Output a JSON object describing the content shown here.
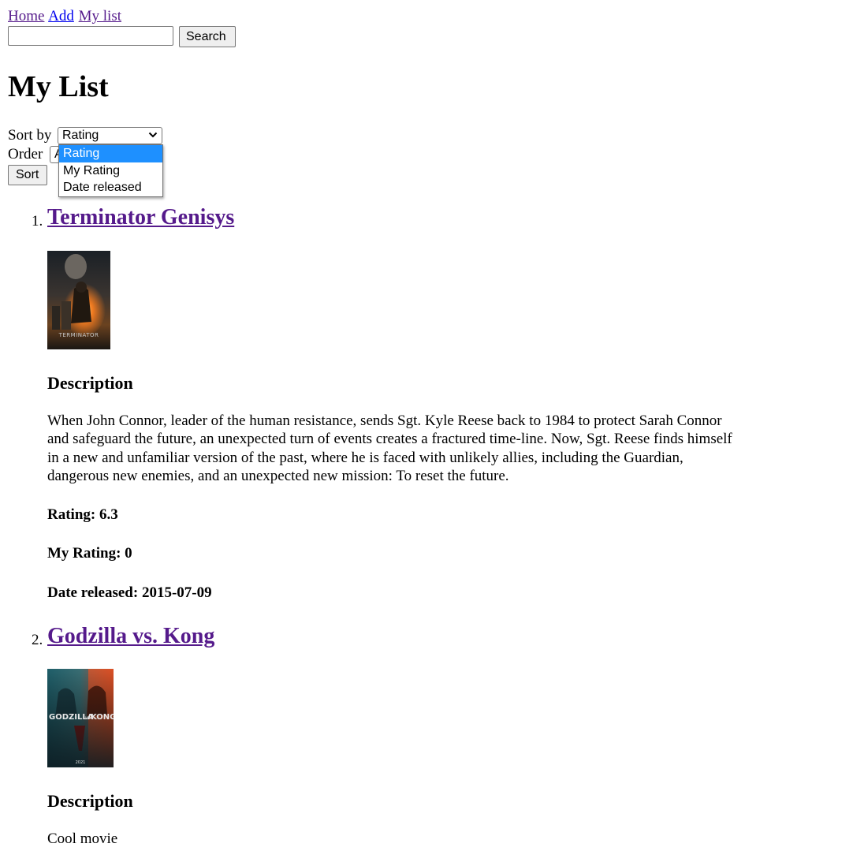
{
  "nav": {
    "home": "Home",
    "add": "Add",
    "my_list": "My list"
  },
  "search": {
    "value": "",
    "button": "Search"
  },
  "page_title": "My List",
  "sort": {
    "label": "Sort by",
    "selected": "Rating",
    "options": [
      "Rating",
      "My Rating",
      "Date released"
    ],
    "order_label": "Order",
    "order_selected_partial": "A",
    "button": "Sort"
  },
  "movies": [
    {
      "number": "1.",
      "title": "Terminator Genisys",
      "description_heading": "Description",
      "description": "When John Connor, leader of the human resistance, sends Sgt. Kyle Reese back to 1984 to protect Sarah Connor and safeguard the future, an unexpected turn of events creates a fractured time-line. Now, Sgt. Reese finds himself in a new and unfamiliar version of the past, where he is faced with unlikely allies, including the Guardian, dangerous new enemies, and an unexpected new mission: To reset the future.",
      "rating": "Rating: 6.3",
      "my_rating": "My Rating: 0",
      "date_released": "Date released: 2015-07-09",
      "poster_text": "TERMINATOR"
    },
    {
      "number": "2.",
      "title": "Godzilla vs. Kong",
      "description_heading": "Description",
      "description": "Cool movie",
      "poster_text_left": "GODZILLA",
      "poster_text_mid": "vs",
      "poster_text_right": "KONG",
      "poster_footer": "2021"
    }
  ],
  "colors": {
    "link_visited": "#551a8b",
    "link_unvisited": "#0000ee",
    "option_highlight": "#1e90ff",
    "button_bg": "#efefef",
    "border": "#767676"
  }
}
